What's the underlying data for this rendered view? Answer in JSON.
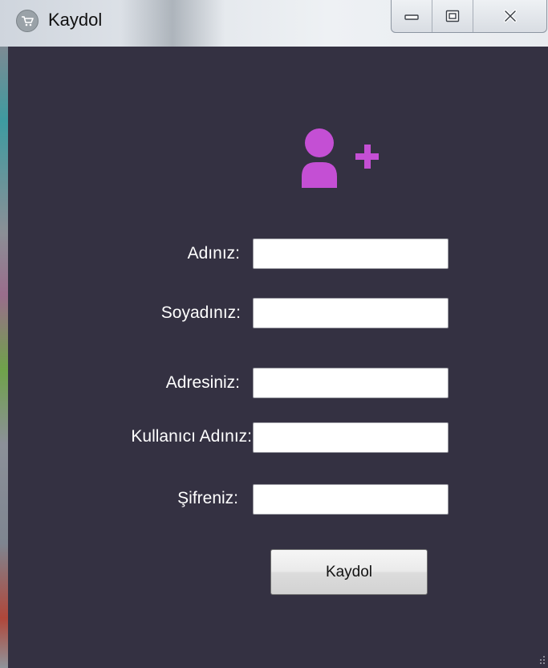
{
  "window": {
    "title": "Kaydol",
    "icon": "cart-icon",
    "controls": [
      "minimize-icon",
      "maximize-icon",
      "close-icon"
    ]
  },
  "theme": {
    "background": "#343142",
    "accent": "#c44fd4",
    "label_color": "#ffffff"
  },
  "header_icon": "user-plus-icon",
  "form": {
    "fields": [
      {
        "label": "Adınız:",
        "value": "",
        "placeholder": ""
      },
      {
        "label": "Soyadınız:",
        "value": "",
        "placeholder": ""
      },
      {
        "label": "Adresiniz:",
        "value": "",
        "placeholder": ""
      },
      {
        "label": "Kullanıcı Adınız:",
        "value": "",
        "placeholder": ""
      },
      {
        "label": "Şifreniz:",
        "value": "",
        "placeholder": ""
      }
    ],
    "submit_label": "Kaydol"
  }
}
